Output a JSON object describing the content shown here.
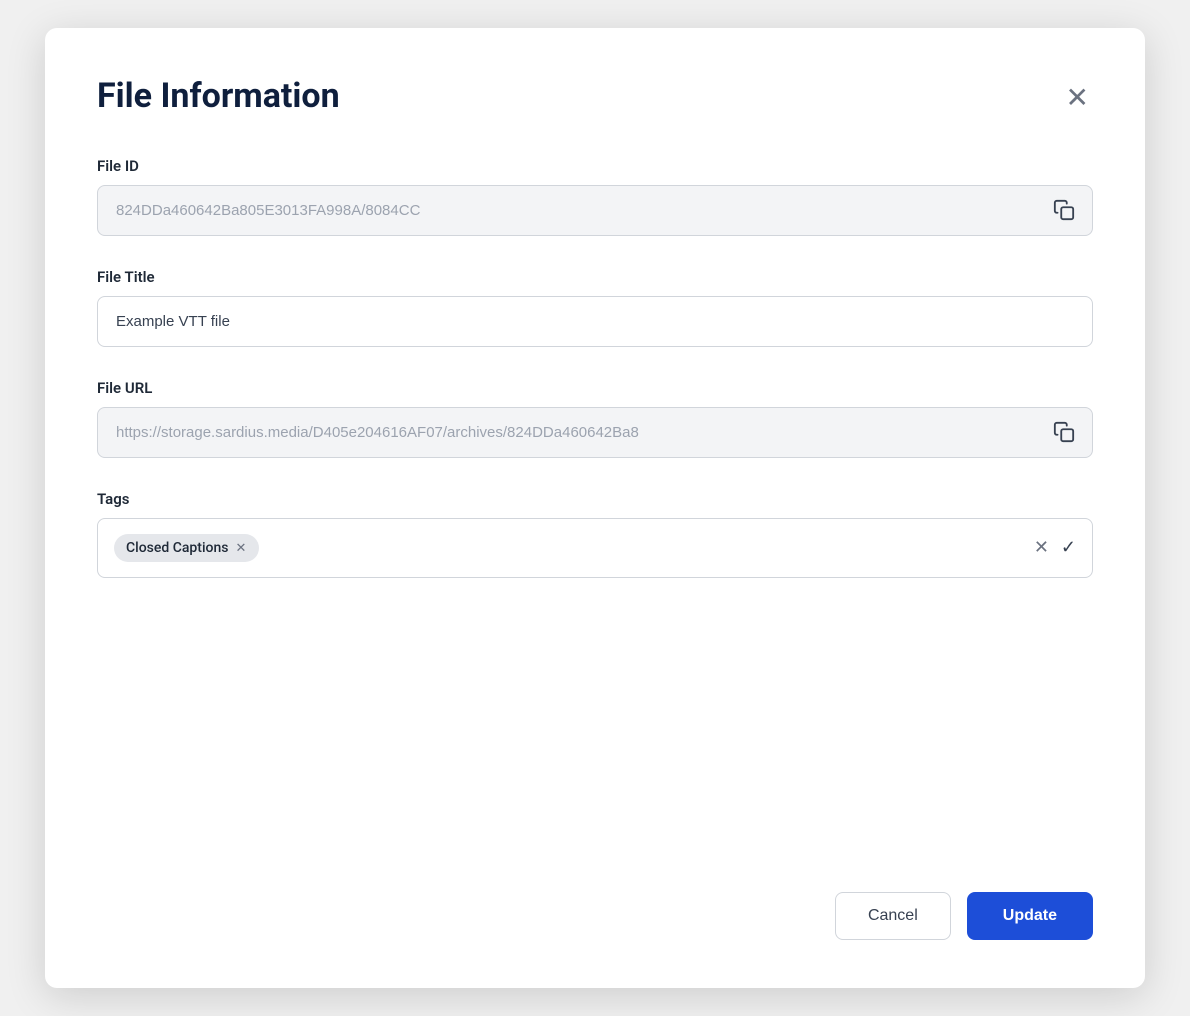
{
  "dialog": {
    "title": "File Information",
    "close_label": "×"
  },
  "fields": {
    "file_id": {
      "label": "File ID",
      "value": "824DDa460642Ba805E3013FA998A/8084CC",
      "placeholder": "",
      "readonly": true
    },
    "file_title": {
      "label": "File Title",
      "value": "Example VTT file",
      "placeholder": ""
    },
    "file_url": {
      "label": "File URL",
      "value": "https://storage.sardius.media/D405e204616AF07/archives/824DDa460642Ba8",
      "placeholder": "",
      "readonly": true
    },
    "tags": {
      "label": "Tags",
      "chips": [
        {
          "label": "Closed Captions"
        }
      ]
    }
  },
  "footer": {
    "cancel_label": "Cancel",
    "update_label": "Update"
  },
  "icons": {
    "copy": "copy-icon",
    "close": "close-icon",
    "tag_remove": "tag-remove-icon",
    "tags_clear": "tags-clear-icon",
    "tags_confirm": "tags-confirm-icon"
  }
}
